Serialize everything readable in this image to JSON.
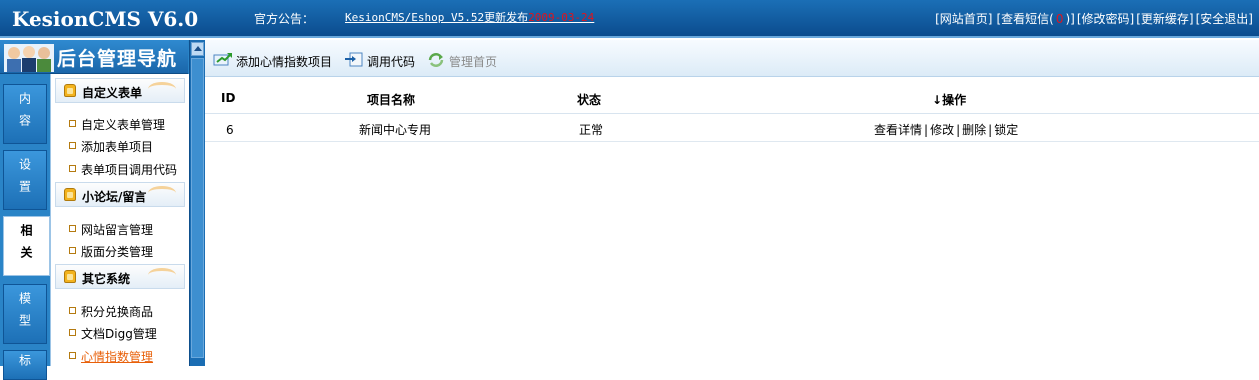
{
  "header": {
    "logo": "KesionCMS V6.0",
    "notice_label": "官方公告：",
    "notice_link": "KesionCMS/Eshop V5.52更新发布",
    "notice_date": "2009-03-24",
    "links": {
      "home": "[网站首页]",
      "sms_prefix": "[查看短信(",
      "sms_count": "0",
      "sms_suffix": ")]",
      "password": "[修改密码]",
      "cache": "[更新缓存]",
      "logout": "[安全退出]"
    }
  },
  "sidebar": {
    "title": "后台管理导航",
    "tabs": [
      "内容",
      "设置",
      "相关",
      "模型",
      "标"
    ],
    "groups": [
      {
        "title": "自定义表单",
        "items": [
          "自定义表单管理",
          "添加表单项目",
          "表单项目调用代码"
        ]
      },
      {
        "title": "小论坛/留言",
        "items": [
          "网站留言管理",
          "版面分类管理"
        ]
      },
      {
        "title": "其它系统",
        "items": [
          "积分兑换商品",
          "文档Digg管理",
          "心情指数管理"
        ]
      }
    ]
  },
  "toolbar": {
    "add": "添加心情指数项目",
    "code": "调用代码",
    "home": "管理首页"
  },
  "table": {
    "headers": {
      "id": "ID",
      "name": "项目名称",
      "status": "状态",
      "ops": "操作",
      "sort_arrow": "↓"
    },
    "rows": [
      {
        "id": "6",
        "name": "新闻中心专用",
        "status": "正常",
        "ops": [
          "查看详情",
          "修改",
          "删除",
          "锁定"
        ],
        "sep": "|"
      }
    ]
  },
  "colors": {
    "header_bg": "#0b4c8e",
    "sidebar_bg": "#2a84c7",
    "notice_date": "#e0141d",
    "active_menu": "#e8600a"
  }
}
